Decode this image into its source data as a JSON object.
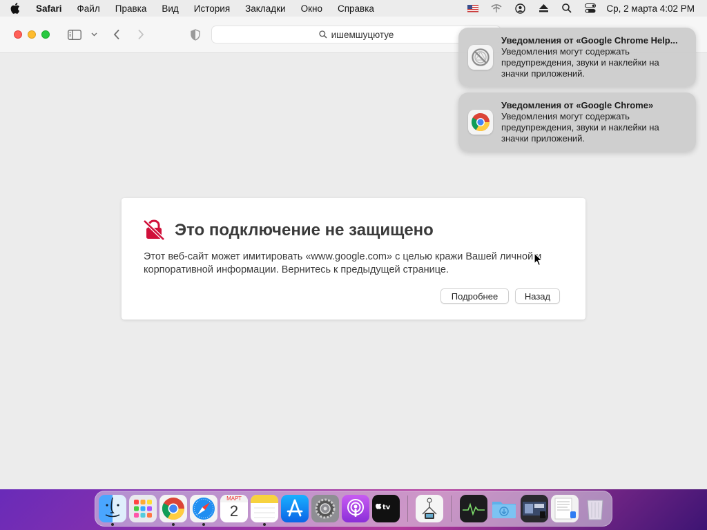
{
  "menubar": {
    "app": "Safari",
    "items": [
      "Файл",
      "Правка",
      "Вид",
      "История",
      "Закладки",
      "Окно",
      "Справка"
    ],
    "clock": "Ср, 2 марта  4:02 PM"
  },
  "browser": {
    "address_text": "ишемшуцютуе"
  },
  "warning": {
    "title": "Это подключение не защищено",
    "body": "Этот веб-сайт может имитировать «www.google.com» с целью кражи Вашей личной и корпоративной информации. Вернитесь к предыдущей странице.",
    "details_label": "Подробнее",
    "back_label": "Назад",
    "accent": "#d0103a"
  },
  "notifications": [
    {
      "title": "Уведомления от «Google Chrome Help...",
      "body": "Уведомления могут содержать предупреждения, звуки и наклейки на значки приложений."
    },
    {
      "title": "Уведомления от «Google Chrome»",
      "body": "Уведомления могут содержать предупреждения, звуки и наклейки на значки приложений."
    }
  ],
  "dock": {
    "calendar_month": "МАРТ",
    "calendar_day": "2",
    "apps": [
      "Finder",
      "Launchpad",
      "Google Chrome",
      "Safari",
      "Календарь",
      "Заметки",
      "App Store",
      "Системные настройки",
      "Подкасты",
      "Apple TV",
      "Утилита",
      "Мониторинг",
      "Загрузки",
      "Недавние",
      "Документы",
      "Корзина"
    ]
  }
}
